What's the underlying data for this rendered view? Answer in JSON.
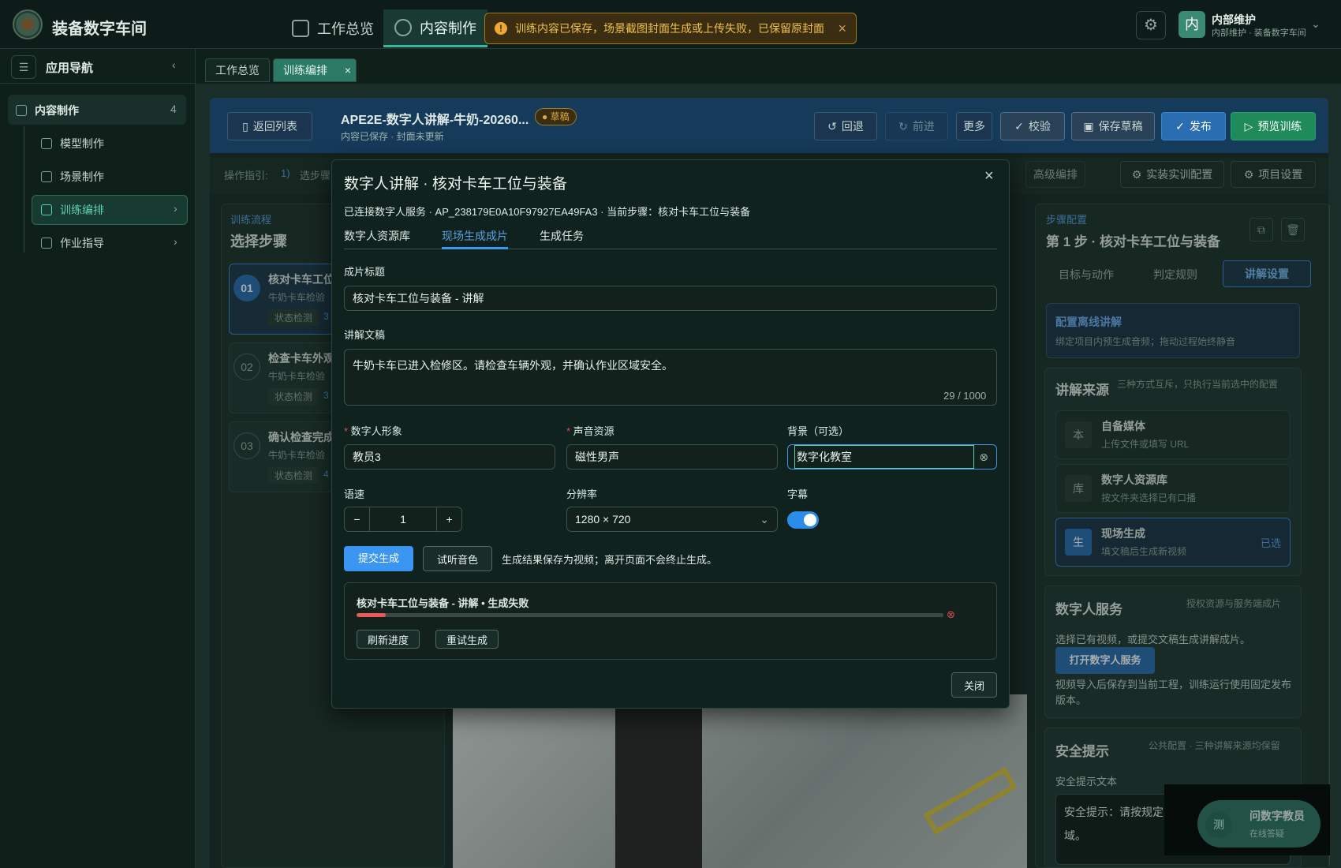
{
  "app": {
    "title": "装备数字车间"
  },
  "topnav": {
    "items": [
      {
        "label": "工作总览"
      },
      {
        "label": "内容制作"
      }
    ]
  },
  "toast": {
    "text": "训练内容已保存，场景截图封面生成或上传失败，已保留原封面",
    "close": "×"
  },
  "user": {
    "name": "内部维护",
    "sub": "内部维护 · 装备数字车间",
    "avatar": "内"
  },
  "sidebar": {
    "title": "应用导航",
    "group": {
      "label": "内容制作",
      "count": "4"
    },
    "items": [
      {
        "label": "模型制作"
      },
      {
        "label": "场景制作"
      },
      {
        "label": "训练编排"
      },
      {
        "label": "作业指导"
      }
    ]
  },
  "tabs": [
    {
      "label": "工作总览"
    },
    {
      "label": "训练编排"
    }
  ],
  "project": {
    "back": "返回列表",
    "name": "APE2E-数字人讲解-牛奶-20260...",
    "status": "草稿",
    "sub": "内容已保存 · 封面未更新",
    "undo": "回退",
    "redo": "前进",
    "more": "更多",
    "check": "校验",
    "save": "保存草稿",
    "publish": "发布",
    "preview": "预览训练"
  },
  "guide": {
    "label": "操作指引:",
    "step": "1)",
    "text": "选步骤",
    "advanced": "高级编排",
    "config": "实装实训配置",
    "settings": "项目设置"
  },
  "flow": {
    "label": "训练流程",
    "title": "选择步骤",
    "steps": [
      {
        "no": "01",
        "title": "核对卡车工位",
        "sub": "牛奶卡车检验",
        "tag": "状态检测",
        "n": "3"
      },
      {
        "no": "02",
        "title": "检查卡车外观",
        "sub": "牛奶卡车检验",
        "tag": "状态检测",
        "n": "3"
      },
      {
        "no": "03",
        "title": "确认检查完成",
        "sub": "牛奶卡车检验",
        "tag": "状态检测",
        "n": "4"
      }
    ]
  },
  "right": {
    "label": "步骤配置",
    "title": "第 1 步 · 核对卡车工位与装备",
    "tabs": [
      "目标与动作",
      "判定规则",
      "讲解设置"
    ],
    "offline": {
      "title": "配置离线讲解",
      "sub": "绑定项目内预生成音频；拖动过程始终静音"
    },
    "source": {
      "title": "讲解来源",
      "hint": "三种方式互斥，只执行当前选中的配置",
      "items": [
        {
          "icon": "本",
          "title": "自备媒体",
          "sub": "上传文件或填写 URL"
        },
        {
          "icon": "库",
          "title": "数字人资源库",
          "sub": "按文件夹选择已有口播"
        },
        {
          "icon": "生",
          "title": "现场生成",
          "sub": "填文稿后生成新视频",
          "selected": "已选"
        }
      ]
    },
    "dh": {
      "title": "数字人服务",
      "hint": "授权资源与服务端成片",
      "text1": "选择已有视频，或提交文稿生成讲解成片。",
      "btn": "打开数字人服务",
      "text2": "视频导入后保存到当前工程，训练运行使用固定发布版本。"
    },
    "safety": {
      "title": "安全提示",
      "hint": "公共配置 · 三种讲解来源均保留",
      "label": "安全提示文本",
      "text": "安全提示：请按规定",
      "text2": "域。"
    }
  },
  "modal": {
    "title": "数字人讲解 · 核对卡车工位与装备",
    "info": "已连接数字人服务 · AP_238179E0A10F97927EA49FA3 · 当前步骤：核对卡车工位与装备",
    "tabs": [
      "数字人资源库",
      "现场生成成片",
      "生成任务"
    ],
    "film_label": "成片标题",
    "film_value": "核对卡车工位与装备 - 讲解",
    "script_label": "讲解文稿",
    "script_value": "牛奶卡车已进入检修区。请检查车辆外观，并确认作业区域安全。",
    "count": "29 / 1000",
    "avatar_label": "数字人形象",
    "avatar_value": "教员3",
    "voice_label": "声音资源",
    "voice_value": "磁性男声",
    "bg_label": "背景（可选）",
    "bg_value": "数字化教室",
    "speed_label": "语速",
    "speed_value": "1",
    "res_label": "分辨率",
    "res_value": "1280 × 720",
    "sub_label": "字幕",
    "submit": "提交生成",
    "listen": "试听音色",
    "note": "生成结果保存为视频；离开页面不会终止生成。",
    "task": {
      "title": "核对卡车工位与装备 - 讲解 • 生成失败",
      "progress": 0.05,
      "refresh": "刷新进度",
      "retry": "重试生成"
    },
    "close": "关闭"
  },
  "chat": {
    "title": "问数字教员",
    "sub": "在线答疑",
    "icon": "测"
  }
}
